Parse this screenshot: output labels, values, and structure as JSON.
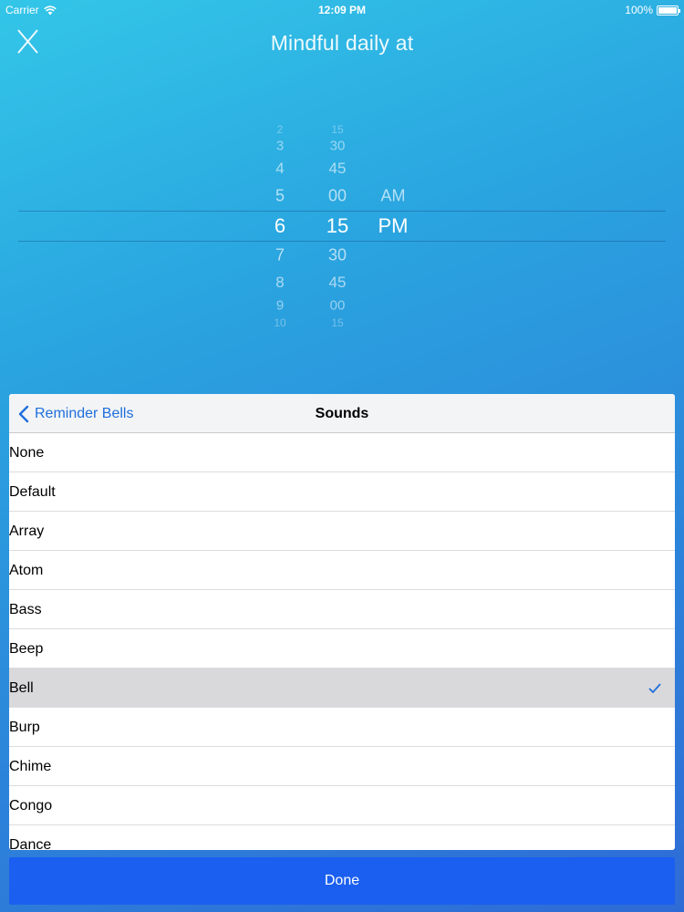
{
  "status_bar": {
    "carrier": "Carrier",
    "time": "12:09 PM",
    "battery": "100%"
  },
  "header": {
    "title": "Mindful daily at",
    "close_icon": "close-icon"
  },
  "picker": {
    "hours": [
      "2",
      "3",
      "4",
      "5",
      "6",
      "7",
      "8",
      "9",
      "10"
    ],
    "minutes": [
      "15",
      "30",
      "45",
      "00",
      "15",
      "30",
      "45",
      "00",
      "15"
    ],
    "periods": [
      "AM",
      "PM"
    ],
    "selected": {
      "hour": "6",
      "minute": "15",
      "period": "PM"
    }
  },
  "sheet": {
    "back_label": "Reminder Bells",
    "title": "Sounds",
    "selected_sound": "Bell",
    "sounds": [
      "None",
      "Default",
      "Array",
      "Atom",
      "Bass",
      "Beep",
      "Bell",
      "Burp",
      "Chime",
      "Congo",
      "Dance"
    ]
  },
  "done_label": "Done",
  "colors": {
    "accent": "#1e6fdc",
    "done_button": "#1b5ff0",
    "selected_row": "#d9d9dc"
  }
}
